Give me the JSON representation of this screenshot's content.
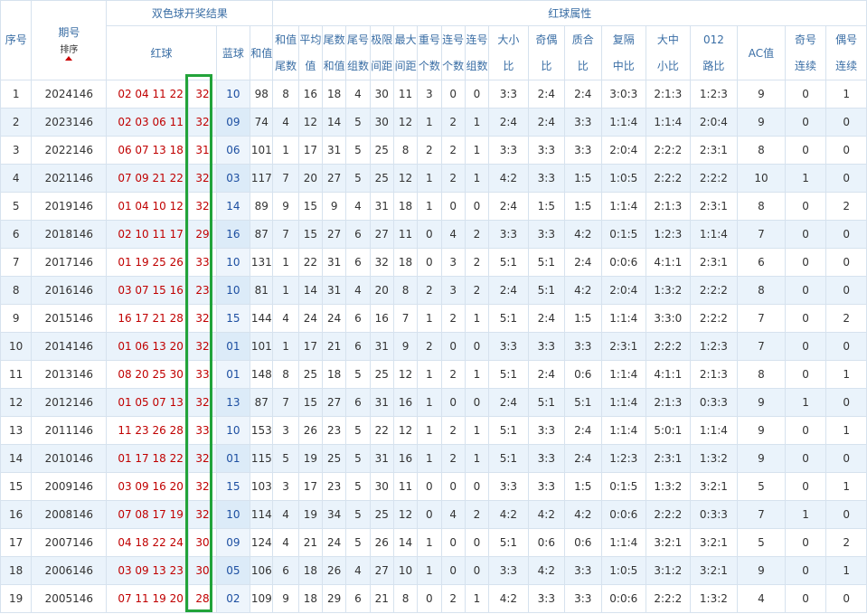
{
  "headers": {
    "seq": "序号",
    "period": "期号",
    "sort": "排序",
    "draw_result": "双色球开奖结果",
    "red_attrs": "红球属性",
    "red_ball": "红球",
    "blue_ball": "蓝球",
    "sum": "和值",
    "cols": [
      [
        "和值",
        "尾数"
      ],
      [
        "平均",
        "值"
      ],
      [
        "尾数",
        "和值"
      ],
      [
        "尾号",
        "组数"
      ],
      [
        "极限",
        "间距"
      ],
      [
        "最大",
        "间距"
      ],
      [
        "重号",
        "个数"
      ],
      [
        "连号",
        "个数"
      ],
      [
        "连号",
        "组数"
      ],
      [
        "大小",
        "比"
      ],
      [
        "奇偶",
        "比"
      ],
      [
        "质合",
        "比"
      ],
      [
        "复隔",
        "中比"
      ],
      [
        "大中",
        "小比"
      ],
      [
        "012",
        "路比"
      ],
      [
        "AC值"
      ],
      [
        "奇号",
        "连续"
      ],
      [
        "偶号",
        "连续"
      ]
    ]
  },
  "rows": [
    {
      "seq": "1",
      "period": "2024146",
      "reds": "02 04 11 22 27",
      "last": "32",
      "blue": "10",
      "vals": [
        "98",
        "8",
        "16",
        "18",
        "4",
        "30",
        "11",
        "3",
        "0",
        "0",
        "3:3",
        "2:4",
        "2:4",
        "3:0:3",
        "2:1:3",
        "1:2:3",
        "9",
        "0",
        "1"
      ]
    },
    {
      "seq": "2",
      "period": "2023146",
      "reds": "02 03 06 11 26",
      "last": "32",
      "blue": "09",
      "vals": [
        "74",
        "4",
        "12",
        "14",
        "5",
        "30",
        "12",
        "1",
        "2",
        "1",
        "2:4",
        "2:4",
        "3:3",
        "1:1:4",
        "1:1:4",
        "2:0:4",
        "9",
        "0",
        "0"
      ]
    },
    {
      "seq": "3",
      "period": "2022146",
      "reds": "06 07 13 18 26",
      "last": "31",
      "blue": "06",
      "vals": [
        "101",
        "1",
        "17",
        "31",
        "5",
        "25",
        "8",
        "2",
        "2",
        "1",
        "3:3",
        "3:3",
        "3:3",
        "2:0:4",
        "2:2:2",
        "2:3:1",
        "8",
        "0",
        "0"
      ]
    },
    {
      "seq": "4",
      "period": "2021146",
      "reds": "07 09 21 22 28",
      "last": "32",
      "blue": "03",
      "vals": [
        "117",
        "7",
        "20",
        "27",
        "5",
        "25",
        "12",
        "1",
        "2",
        "1",
        "4:2",
        "3:3",
        "1:5",
        "1:0:5",
        "2:2:2",
        "2:2:2",
        "10",
        "1",
        "0"
      ]
    },
    {
      "seq": "5",
      "period": "2019146",
      "reds": "01 04 10 12 30",
      "last": "32",
      "blue": "14",
      "vals": [
        "89",
        "9",
        "15",
        "9",
        "4",
        "31",
        "18",
        "1",
        "0",
        "0",
        "2:4",
        "1:5",
        "1:5",
        "1:1:4",
        "2:1:3",
        "2:3:1",
        "8",
        "0",
        "2"
      ]
    },
    {
      "seq": "6",
      "period": "2018146",
      "reds": "02 10 11 17 18",
      "last": "29",
      "blue": "16",
      "vals": [
        "87",
        "7",
        "15",
        "27",
        "6",
        "27",
        "11",
        "0",
        "4",
        "2",
        "3:3",
        "3:3",
        "4:2",
        "0:1:5",
        "1:2:3",
        "1:1:4",
        "7",
        "0",
        "0"
      ]
    },
    {
      "seq": "7",
      "period": "2017146",
      "reds": "01 19 25 26 27",
      "last": "33",
      "blue": "10",
      "vals": [
        "131",
        "1",
        "22",
        "31",
        "6",
        "32",
        "18",
        "0",
        "3",
        "2",
        "5:1",
        "5:1",
        "2:4",
        "0:0:6",
        "4:1:1",
        "2:3:1",
        "6",
        "0",
        "0"
      ]
    },
    {
      "seq": "8",
      "period": "2016146",
      "reds": "03 07 15 16 17",
      "last": "23",
      "blue": "10",
      "vals": [
        "81",
        "1",
        "14",
        "31",
        "4",
        "20",
        "8",
        "2",
        "3",
        "2",
        "2:4",
        "5:1",
        "4:2",
        "2:0:4",
        "1:3:2",
        "2:2:2",
        "8",
        "0",
        "0"
      ]
    },
    {
      "seq": "9",
      "period": "2015146",
      "reds": "16 17 21 28 30",
      "last": "32",
      "blue": "15",
      "vals": [
        "144",
        "4",
        "24",
        "24",
        "6",
        "16",
        "7",
        "1",
        "2",
        "1",
        "5:1",
        "2:4",
        "1:5",
        "1:1:4",
        "3:3:0",
        "2:2:2",
        "7",
        "0",
        "2"
      ]
    },
    {
      "seq": "10",
      "period": "2014146",
      "reds": "01 06 13 20 28",
      "last": "32",
      "blue": "01",
      "vals": [
        "101",
        "1",
        "17",
        "21",
        "6",
        "31",
        "9",
        "2",
        "0",
        "0",
        "3:3",
        "3:3",
        "3:3",
        "2:3:1",
        "2:2:2",
        "1:2:3",
        "7",
        "0",
        "0"
      ]
    },
    {
      "seq": "11",
      "period": "2013146",
      "reds": "08 20 25 30 31",
      "last": "33",
      "blue": "01",
      "vals": [
        "148",
        "8",
        "25",
        "18",
        "5",
        "25",
        "12",
        "1",
        "2",
        "1",
        "5:1",
        "2:4",
        "0:6",
        "1:1:4",
        "4:1:1",
        "2:1:3",
        "8",
        "0",
        "1"
      ]
    },
    {
      "seq": "12",
      "period": "2012146",
      "reds": "01 05 07 13 28",
      "last": "32",
      "blue": "13",
      "vals": [
        "87",
        "7",
        "15",
        "27",
        "6",
        "31",
        "16",
        "1",
        "0",
        "0",
        "2:4",
        "5:1",
        "5:1",
        "1:1:4",
        "2:1:3",
        "0:3:3",
        "9",
        "1",
        "0"
      ]
    },
    {
      "seq": "13",
      "period": "2011146",
      "reds": "11 23 26 28 30",
      "last": "33",
      "blue": "10",
      "vals": [
        "153",
        "3",
        "26",
        "23",
        "5",
        "22",
        "12",
        "1",
        "2",
        "1",
        "5:1",
        "3:3",
        "2:4",
        "1:1:4",
        "5:0:1",
        "1:1:4",
        "9",
        "0",
        "1"
      ]
    },
    {
      "seq": "14",
      "period": "2010146",
      "reds": "01 17 18 22 28",
      "last": "32",
      "blue": "01",
      "vals": [
        "115",
        "5",
        "19",
        "25",
        "5",
        "31",
        "16",
        "1",
        "2",
        "1",
        "5:1",
        "3:3",
        "2:4",
        "1:2:3",
        "2:3:1",
        "1:3:2",
        "9",
        "0",
        "0"
      ]
    },
    {
      "seq": "15",
      "period": "2009146",
      "reds": "03 09 16 20 28",
      "last": "32",
      "blue": "15",
      "vals": [
        "103",
        "3",
        "17",
        "23",
        "5",
        "30",
        "11",
        "0",
        "0",
        "0",
        "3:3",
        "3:3",
        "1:5",
        "0:1:5",
        "1:3:2",
        "3:2:1",
        "5",
        "0",
        "1"
      ]
    },
    {
      "seq": "16",
      "period": "2008146",
      "reds": "07 08 17 19 30",
      "last": "32",
      "blue": "10",
      "vals": [
        "114",
        "4",
        "19",
        "34",
        "5",
        "25",
        "12",
        "0",
        "4",
        "2",
        "4:2",
        "4:2",
        "4:2",
        "0:0:6",
        "2:2:2",
        "0:3:3",
        "7",
        "1",
        "0"
      ]
    },
    {
      "seq": "17",
      "period": "2007146",
      "reds": "04 18 22 24 25",
      "last": "30",
      "blue": "09",
      "vals": [
        "124",
        "4",
        "21",
        "24",
        "5",
        "26",
        "14",
        "1",
        "0",
        "0",
        "5:1",
        "0:6",
        "0:6",
        "1:1:4",
        "3:2:1",
        "3:2:1",
        "5",
        "0",
        "2"
      ]
    },
    {
      "seq": "18",
      "period": "2006146",
      "reds": "03 09 13 23 26",
      "last": "30",
      "blue": "05",
      "vals": [
        "106",
        "6",
        "18",
        "26",
        "4",
        "27",
        "10",
        "1",
        "0",
        "0",
        "3:3",
        "4:2",
        "3:3",
        "1:0:5",
        "3:1:2",
        "3:2:1",
        "9",
        "0",
        "1"
      ]
    },
    {
      "seq": "19",
      "period": "2005146",
      "reds": "07 11 19 20 24",
      "last": "28",
      "blue": "02",
      "vals": [
        "109",
        "9",
        "18",
        "29",
        "6",
        "21",
        "8",
        "0",
        "2",
        "1",
        "4:2",
        "3:3",
        "3:3",
        "0:0:6",
        "2:2:2",
        "1:3:2",
        "4",
        "0",
        "0"
      ]
    }
  ]
}
